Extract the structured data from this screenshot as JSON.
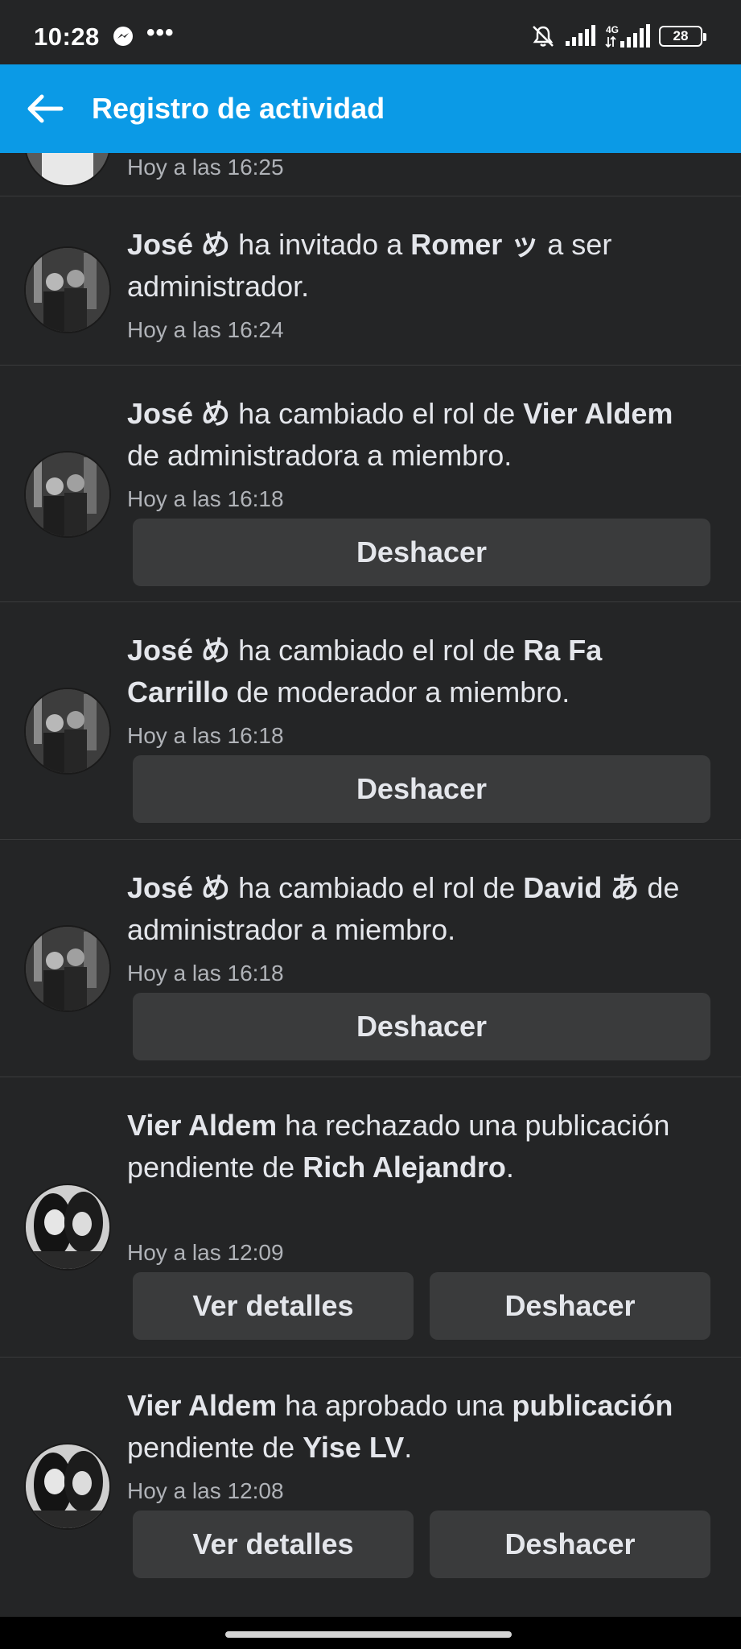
{
  "status_bar": {
    "time": "10:28",
    "network_label": "4G",
    "battery": "28",
    "icons": [
      "messenger-icon",
      "more-dots-icon",
      "bell-muted-icon",
      "signal-icon",
      "network-signal-icon",
      "battery-icon"
    ],
    "dots": "•••"
  },
  "app_bar": {
    "title": "Registro de actividad",
    "back_icon": "arrow-left-icon",
    "color": "#0b9ae6"
  },
  "partial_item": {
    "time": "Hoy a las 16:25"
  },
  "items": [
    {
      "actor": "José め",
      "t1": " ha invitado a ",
      "target": "Romer ッ",
      "t2": " a ser administrador.",
      "time": "Hoy a las 16:24"
    },
    {
      "actor": "José め",
      "t1": " ha cambiado el rol de ",
      "target": "Vier Aldem",
      "t2": " de administradora a miembro.",
      "time": "Hoy a las 16:18",
      "button": "Deshacer"
    },
    {
      "actor": "José め",
      "t1": " ha cambiado el rol de ",
      "target": "Ra Fa Carrillo",
      "t2": " de moderador a miembro.",
      "time": "Hoy a las 16:18",
      "button": "Deshacer"
    },
    {
      "actor": "José め",
      "t1": " ha cambiado el rol de ",
      "target": "David あ",
      "t2": " de administrador a miembro.",
      "time": "Hoy a las 16:18",
      "button": "Deshacer"
    },
    {
      "actor": "Vier Aldem",
      "t1": " ha rechazado una publicación pendiente de ",
      "target": "Rich Alejandro",
      "t2": ".",
      "time": "Hoy a las 12:09",
      "button_left": "Ver detalles",
      "button_right": "Deshacer"
    },
    {
      "actor": "Vier Aldem",
      "t1": " ha aprobado una ",
      "object": "publicación",
      "t2": " pendiente de ",
      "target": "Yise LV",
      "t3": ".",
      "time": "Hoy a las 12:08",
      "button_left": "Ver detalles",
      "button_right": "Deshacer"
    }
  ]
}
